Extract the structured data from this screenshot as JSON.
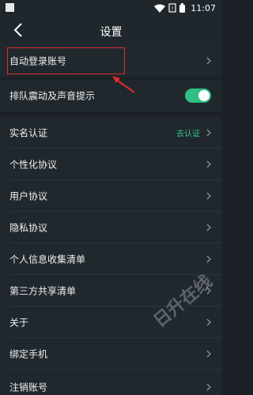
{
  "status_bar": {
    "time": "11:07",
    "icons": [
      "wifi-icon",
      "sim-icon",
      "battery-icon"
    ]
  },
  "header": {
    "title": "设置"
  },
  "settings": {
    "auto_login": "自动登录账号",
    "queue_vibration": "排队震动及声音提示",
    "queue_vibration_enabled": true,
    "real_name": "实名认证",
    "real_name_action": "去认证",
    "personalization": "个性化协议",
    "user_agreement": "用户协议",
    "privacy": "隐私协议",
    "personal_info": "个人信息收集清单",
    "third_party": "第三方共享清单",
    "about": "关于",
    "bind_phone": "绑定手机",
    "cancel_account": "注销账号"
  },
  "watermark": "日升在线",
  "colors": {
    "accent": "#2fbf83",
    "annotation": "#e02b2b",
    "background": "#1a2026"
  }
}
